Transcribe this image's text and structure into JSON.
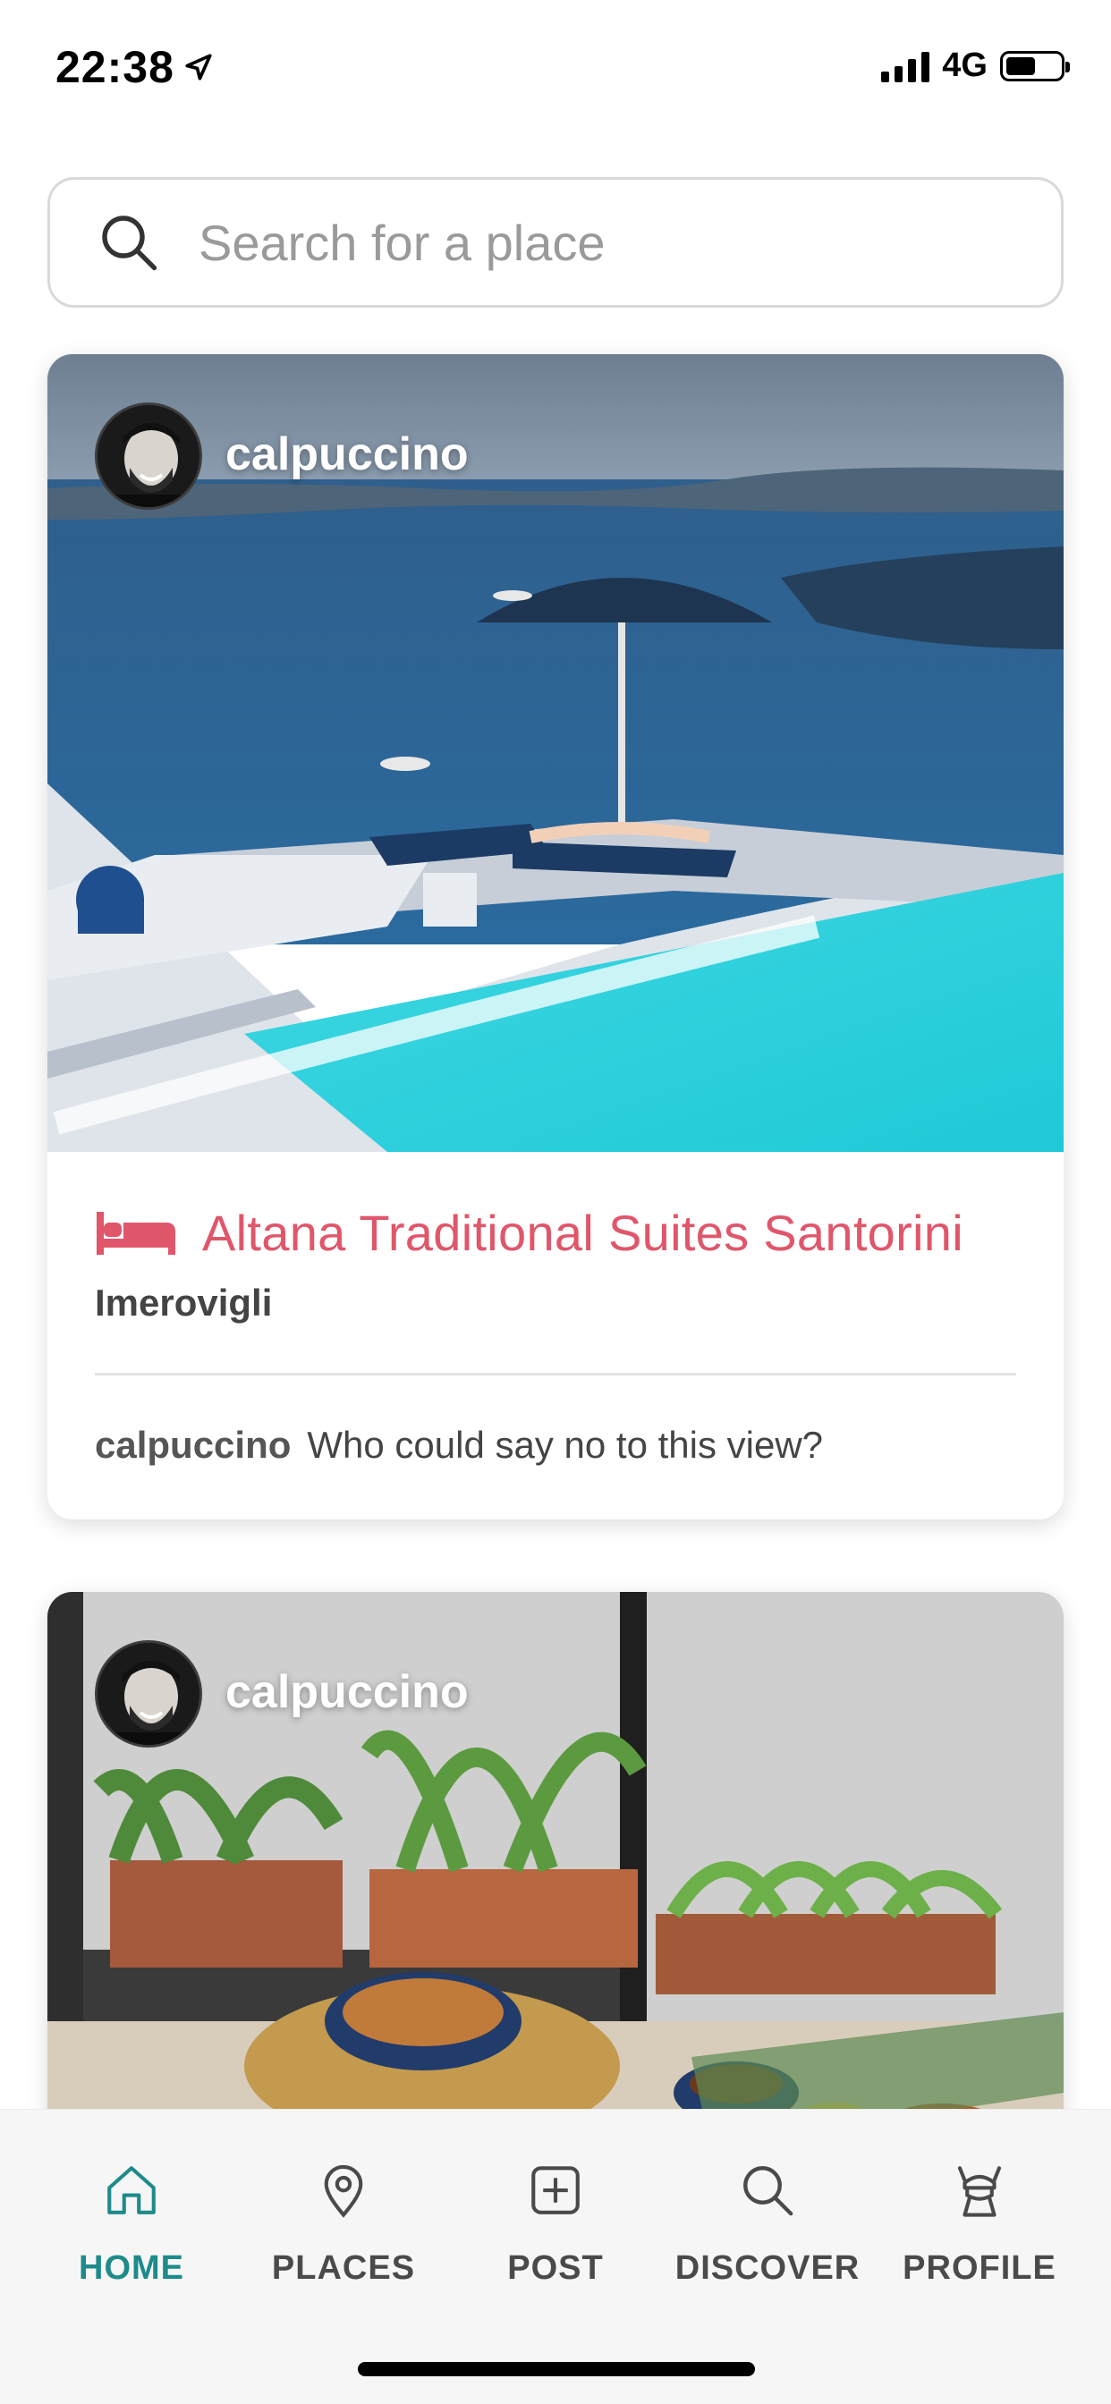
{
  "status_bar": {
    "time": "22:38",
    "network": "4G",
    "battery_level": 0.55
  },
  "search": {
    "placeholder": "Search for a place",
    "value": ""
  },
  "posts": [
    {
      "username": "calpuccino",
      "place_type_icon": "bed-icon",
      "place_name": "Altana Traditional Suites Santorini",
      "location": "Imerovigli",
      "caption_user": "calpuccino",
      "caption": "Who could say no to this view?",
      "image_description_icon": "santorini-pool-photo"
    },
    {
      "username": "calpuccino",
      "image_description_icon": "food-table-photo"
    }
  ],
  "tab_bar": {
    "tabs": [
      {
        "label": "HOME",
        "icon": "home-icon",
        "active": true
      },
      {
        "label": "PLACES",
        "icon": "map-pin-icon",
        "active": false
      },
      {
        "label": "POST",
        "icon": "plus-square-icon",
        "active": false
      },
      {
        "label": "DISCOVER",
        "icon": "search-icon",
        "active": false
      },
      {
        "label": "PROFILE",
        "icon": "viking-icon",
        "active": false
      }
    ]
  },
  "colors": {
    "accent": "#1f8a8a",
    "place_name": "#e0566a",
    "tab_inactive": "#4a4a4a"
  }
}
